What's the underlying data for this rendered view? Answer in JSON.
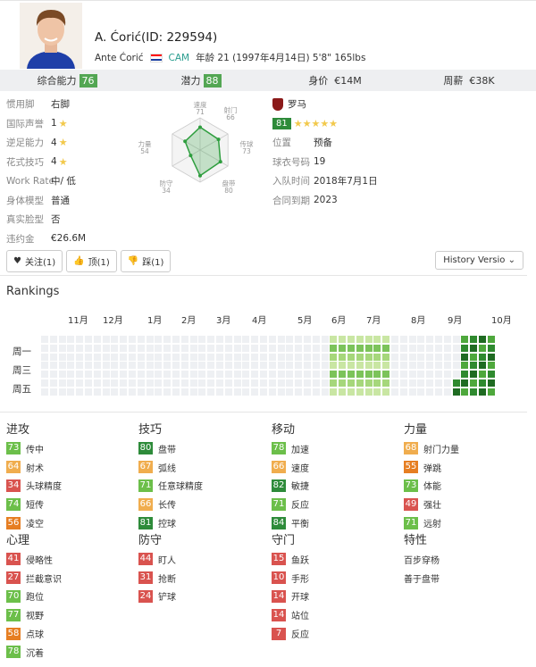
{
  "player": {
    "name": "A. Ćorić(ID: 229594)",
    "full_name": "Ante Ćorić",
    "position": "CAM",
    "age_line": "年龄 21 (1997年4月14日) 5'8\" 165lbs"
  },
  "summary": [
    {
      "label": "综合能力",
      "value": "76",
      "badge": true
    },
    {
      "label": "潜力",
      "value": "88",
      "badge": true
    },
    {
      "label": "身价",
      "value": "€14M",
      "badge": false
    },
    {
      "label": "周薪",
      "value": "€38K",
      "badge": false
    }
  ],
  "info_left": [
    {
      "k": "惯用脚",
      "v": "右脚",
      "stars": false
    },
    {
      "k": "国际声誉",
      "v": "1",
      "stars": true
    },
    {
      "k": "逆足能力",
      "v": "4",
      "stars": true
    },
    {
      "k": "花式技巧",
      "v": "4",
      "stars": true
    },
    {
      "k": "Work Rate",
      "v": "中/ 低",
      "stars": false
    },
    {
      "k": "身体模型",
      "v": "普通",
      "stars": false
    },
    {
      "k": "真实脸型",
      "v": "否",
      "stars": false
    },
    {
      "k": "违约金",
      "v": "€26.6M",
      "stars": false
    }
  ],
  "radar": {
    "labels": [
      {
        "name": "速度",
        "val": "71"
      },
      {
        "name": "射门",
        "val": "66"
      },
      {
        "name": "传球",
        "val": "73"
      },
      {
        "name": "盘带",
        "val": "80"
      },
      {
        "name": "防守",
        "val": "34"
      },
      {
        "name": "力量",
        "val": "54"
      }
    ],
    "values": [
      71,
      66,
      73,
      80,
      34,
      54
    ],
    "color": "#2e9e3e"
  },
  "club": {
    "name": "罗马",
    "rating": "81",
    "stars": "★★★★★",
    "rows": [
      {
        "k": "位置",
        "v": "预备"
      },
      {
        "k": "球衣号码",
        "v": "19"
      },
      {
        "k": "入队时间",
        "v": "2018年7月1日"
      },
      {
        "k": "合同到期",
        "v": "2023"
      }
    ]
  },
  "buttons": {
    "follow": "关注(1)",
    "up": "顶(1)",
    "down": "踩(1)",
    "history": "History Versio"
  },
  "rankings": {
    "title": "Rankings",
    "months": [
      "11月",
      "12月",
      "1月",
      "2月",
      "3月",
      "4月",
      "5月",
      "6月",
      "7月",
      "8月",
      "9月",
      "10月"
    ],
    "days": [
      "周一",
      "周三",
      "周五"
    ]
  },
  "stats": [
    {
      "head": "进攻",
      "rows": [
        {
          "v": "73",
          "l": "传中"
        },
        {
          "v": "64",
          "l": "射术"
        },
        {
          "v": "34",
          "l": "头球精度"
        },
        {
          "v": "74",
          "l": "短传"
        },
        {
          "v": "56",
          "l": "凌空"
        }
      ]
    },
    {
      "head": "技巧",
      "rows": [
        {
          "v": "80",
          "l": "盘带"
        },
        {
          "v": "67",
          "l": "弧线"
        },
        {
          "v": "71",
          "l": "任意球精度"
        },
        {
          "v": "66",
          "l": "长传"
        },
        {
          "v": "81",
          "l": "控球"
        }
      ]
    },
    {
      "head": "移动",
      "rows": [
        {
          "v": "78",
          "l": "加速"
        },
        {
          "v": "66",
          "l": "速度"
        },
        {
          "v": "82",
          "l": "敏捷"
        },
        {
          "v": "71",
          "l": "反应"
        },
        {
          "v": "84",
          "l": "平衡"
        }
      ]
    },
    {
      "head": "力量",
      "rows": [
        {
          "v": "68",
          "l": "射门力量"
        },
        {
          "v": "55",
          "l": "弹跳"
        },
        {
          "v": "73",
          "l": "体能"
        },
        {
          "v": "49",
          "l": "强壮"
        },
        {
          "v": "71",
          "l": "远射"
        }
      ]
    },
    {
      "head": "心理",
      "rows": [
        {
          "v": "41",
          "l": "侵略性"
        },
        {
          "v": "27",
          "l": "拦截意识"
        },
        {
          "v": "70",
          "l": "跑位"
        },
        {
          "v": "77",
          "l": "视野"
        },
        {
          "v": "58",
          "l": "点球"
        },
        {
          "v": "78",
          "l": "沉着"
        }
      ]
    },
    {
      "head": "防守",
      "rows": [
        {
          "v": "44",
          "l": "盯人"
        },
        {
          "v": "31",
          "l": "抢断"
        },
        {
          "v": "24",
          "l": "铲球"
        }
      ]
    },
    {
      "head": "守门",
      "rows": [
        {
          "v": "15",
          "l": "鱼跃"
        },
        {
          "v": "10",
          "l": "手形"
        },
        {
          "v": "14",
          "l": "开球"
        },
        {
          "v": "14",
          "l": "站位"
        },
        {
          "v": "7",
          "l": "反应"
        }
      ]
    },
    {
      "head": "特性",
      "traits": [
        "百步穿杨",
        "善于盘带"
      ]
    }
  ]
}
